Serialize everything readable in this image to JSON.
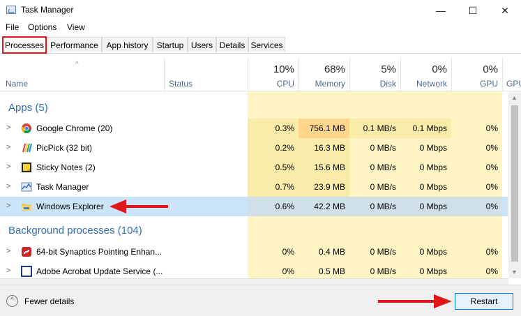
{
  "window": {
    "title": "Task Manager",
    "minimize": "—",
    "maximize": "☐",
    "close": "✕"
  },
  "menu": [
    "File",
    "Options",
    "View"
  ],
  "tabs": [
    "Processes",
    "Performance",
    "App history",
    "Startup",
    "Users",
    "Details",
    "Services"
  ],
  "columns": {
    "name": "Name",
    "status": "Status",
    "cpu": {
      "pct": "10%",
      "label": "CPU"
    },
    "memory": {
      "pct": "68%",
      "label": "Memory"
    },
    "disk": {
      "pct": "5%",
      "label": "Disk"
    },
    "network": {
      "pct": "0%",
      "label": "Network"
    },
    "gpu": {
      "pct": "0%",
      "label": "GPU"
    },
    "gpu_engine_partial": "GPU"
  },
  "groups": {
    "apps": "Apps (5)",
    "background": "Background processes (104)"
  },
  "apps": [
    {
      "name": "Google Chrome (20)",
      "icon": "chrome-icon",
      "cpu": "0.3%",
      "memory": "756.1 MB",
      "disk": "0.1 MB/s",
      "network": "0.1 Mbps",
      "gpu": "0%"
    },
    {
      "name": "PicPick (32 bit)",
      "icon": "picpick-icon",
      "cpu": "0.2%",
      "memory": "16.3 MB",
      "disk": "0 MB/s",
      "network": "0 Mbps",
      "gpu": "0%"
    },
    {
      "name": "Sticky Notes (2)",
      "icon": "sticky-notes-icon",
      "cpu": "0.5%",
      "memory": "15.6 MB",
      "disk": "0 MB/s",
      "network": "0 Mbps",
      "gpu": "0%"
    },
    {
      "name": "Task Manager",
      "icon": "task-manager-icon",
      "cpu": "0.7%",
      "memory": "23.9 MB",
      "disk": "0 MB/s",
      "network": "0 Mbps",
      "gpu": "0%"
    },
    {
      "name": "Windows Explorer",
      "icon": "folder-icon",
      "cpu": "0.6%",
      "memory": "42.2 MB",
      "disk": "0 MB/s",
      "network": "0 Mbps",
      "gpu": "0%"
    }
  ],
  "background": [
    {
      "name": "64-bit Synaptics Pointing Enhan...",
      "icon": "synaptics-icon",
      "cpu": "0%",
      "memory": "0.4 MB",
      "disk": "0 MB/s",
      "network": "0 Mbps",
      "gpu": "0%"
    },
    {
      "name": "Adobe Acrobat Update Service (...",
      "icon": "adobe-icon",
      "cpu": "0%",
      "memory": "0.5 MB",
      "disk": "0 MB/s",
      "network": "0 Mbps",
      "gpu": "0%"
    }
  ],
  "footer": {
    "fewer_details": "Fewer details",
    "restart": "Restart"
  },
  "colors": {
    "accent": "#0078d7",
    "group": "#2e6db4",
    "heat_light": "#fff4c4",
    "heat_mid": "#f9eca8",
    "heat_strong": "#ffd68a",
    "selection": "#cce4f7",
    "annotation": "#e0161b"
  }
}
